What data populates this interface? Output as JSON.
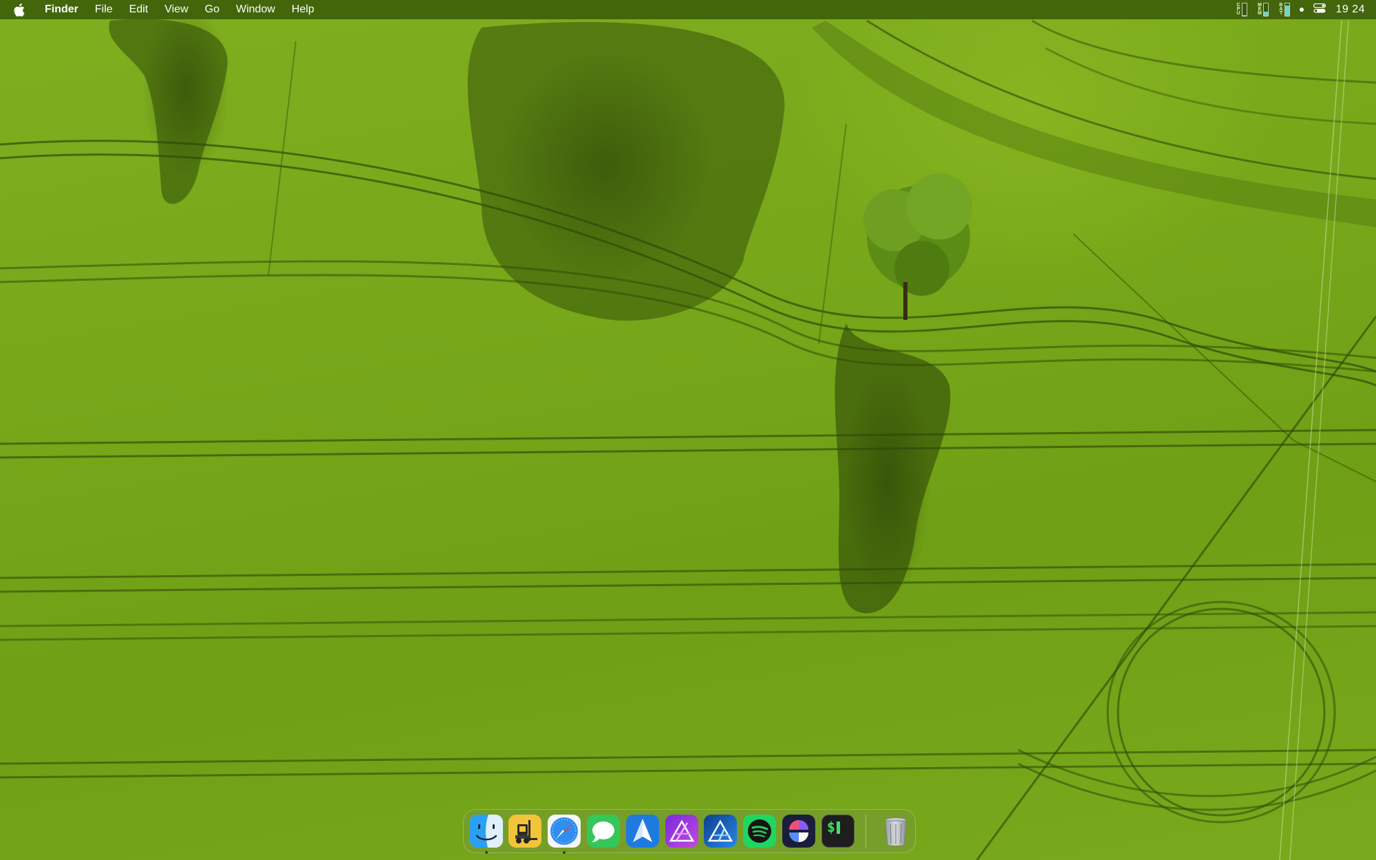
{
  "menubar": {
    "apple_icon": "apple-logo-icon",
    "app_name": "Finder",
    "menus": [
      "File",
      "Edit",
      "View",
      "Go",
      "Window",
      "Help"
    ],
    "status": {
      "cpu_label": "CPU",
      "cpu_level": 0.05,
      "mem_label": "MEM",
      "mem_level": 0.35,
      "bat_label": "BAT",
      "bat_level": 0.85,
      "clock": "19 24"
    }
  },
  "dock": {
    "apps": [
      {
        "name": "Finder",
        "icon": "finder-icon",
        "running": true
      },
      {
        "name": "Transmit",
        "icon": "forklift-icon",
        "running": false
      },
      {
        "name": "Safari",
        "icon": "safari-compass-icon",
        "running": true
      },
      {
        "name": "Messages",
        "icon": "messages-bubble-icon",
        "running": false
      },
      {
        "name": "Spark",
        "icon": "paper-plane-icon",
        "running": false
      },
      {
        "name": "Affinity Photo",
        "icon": "affinity-photo-icon",
        "running": false
      },
      {
        "name": "Affinity Designer",
        "icon": "affinity-designer-icon",
        "running": false
      },
      {
        "name": "Spotify",
        "icon": "spotify-icon",
        "running": false
      },
      {
        "name": "Setapp",
        "icon": "setapp-icon",
        "running": false
      },
      {
        "name": "Terminal",
        "icon": "terminal-icon",
        "running": false
      }
    ],
    "trash": {
      "name": "Trash",
      "icon": "trash-icon"
    },
    "terminal_glyph": "$"
  },
  "colors": {
    "menubar_bg": "#3e600a",
    "field_green": "#78a81a",
    "dock_bg": "#78963c"
  }
}
